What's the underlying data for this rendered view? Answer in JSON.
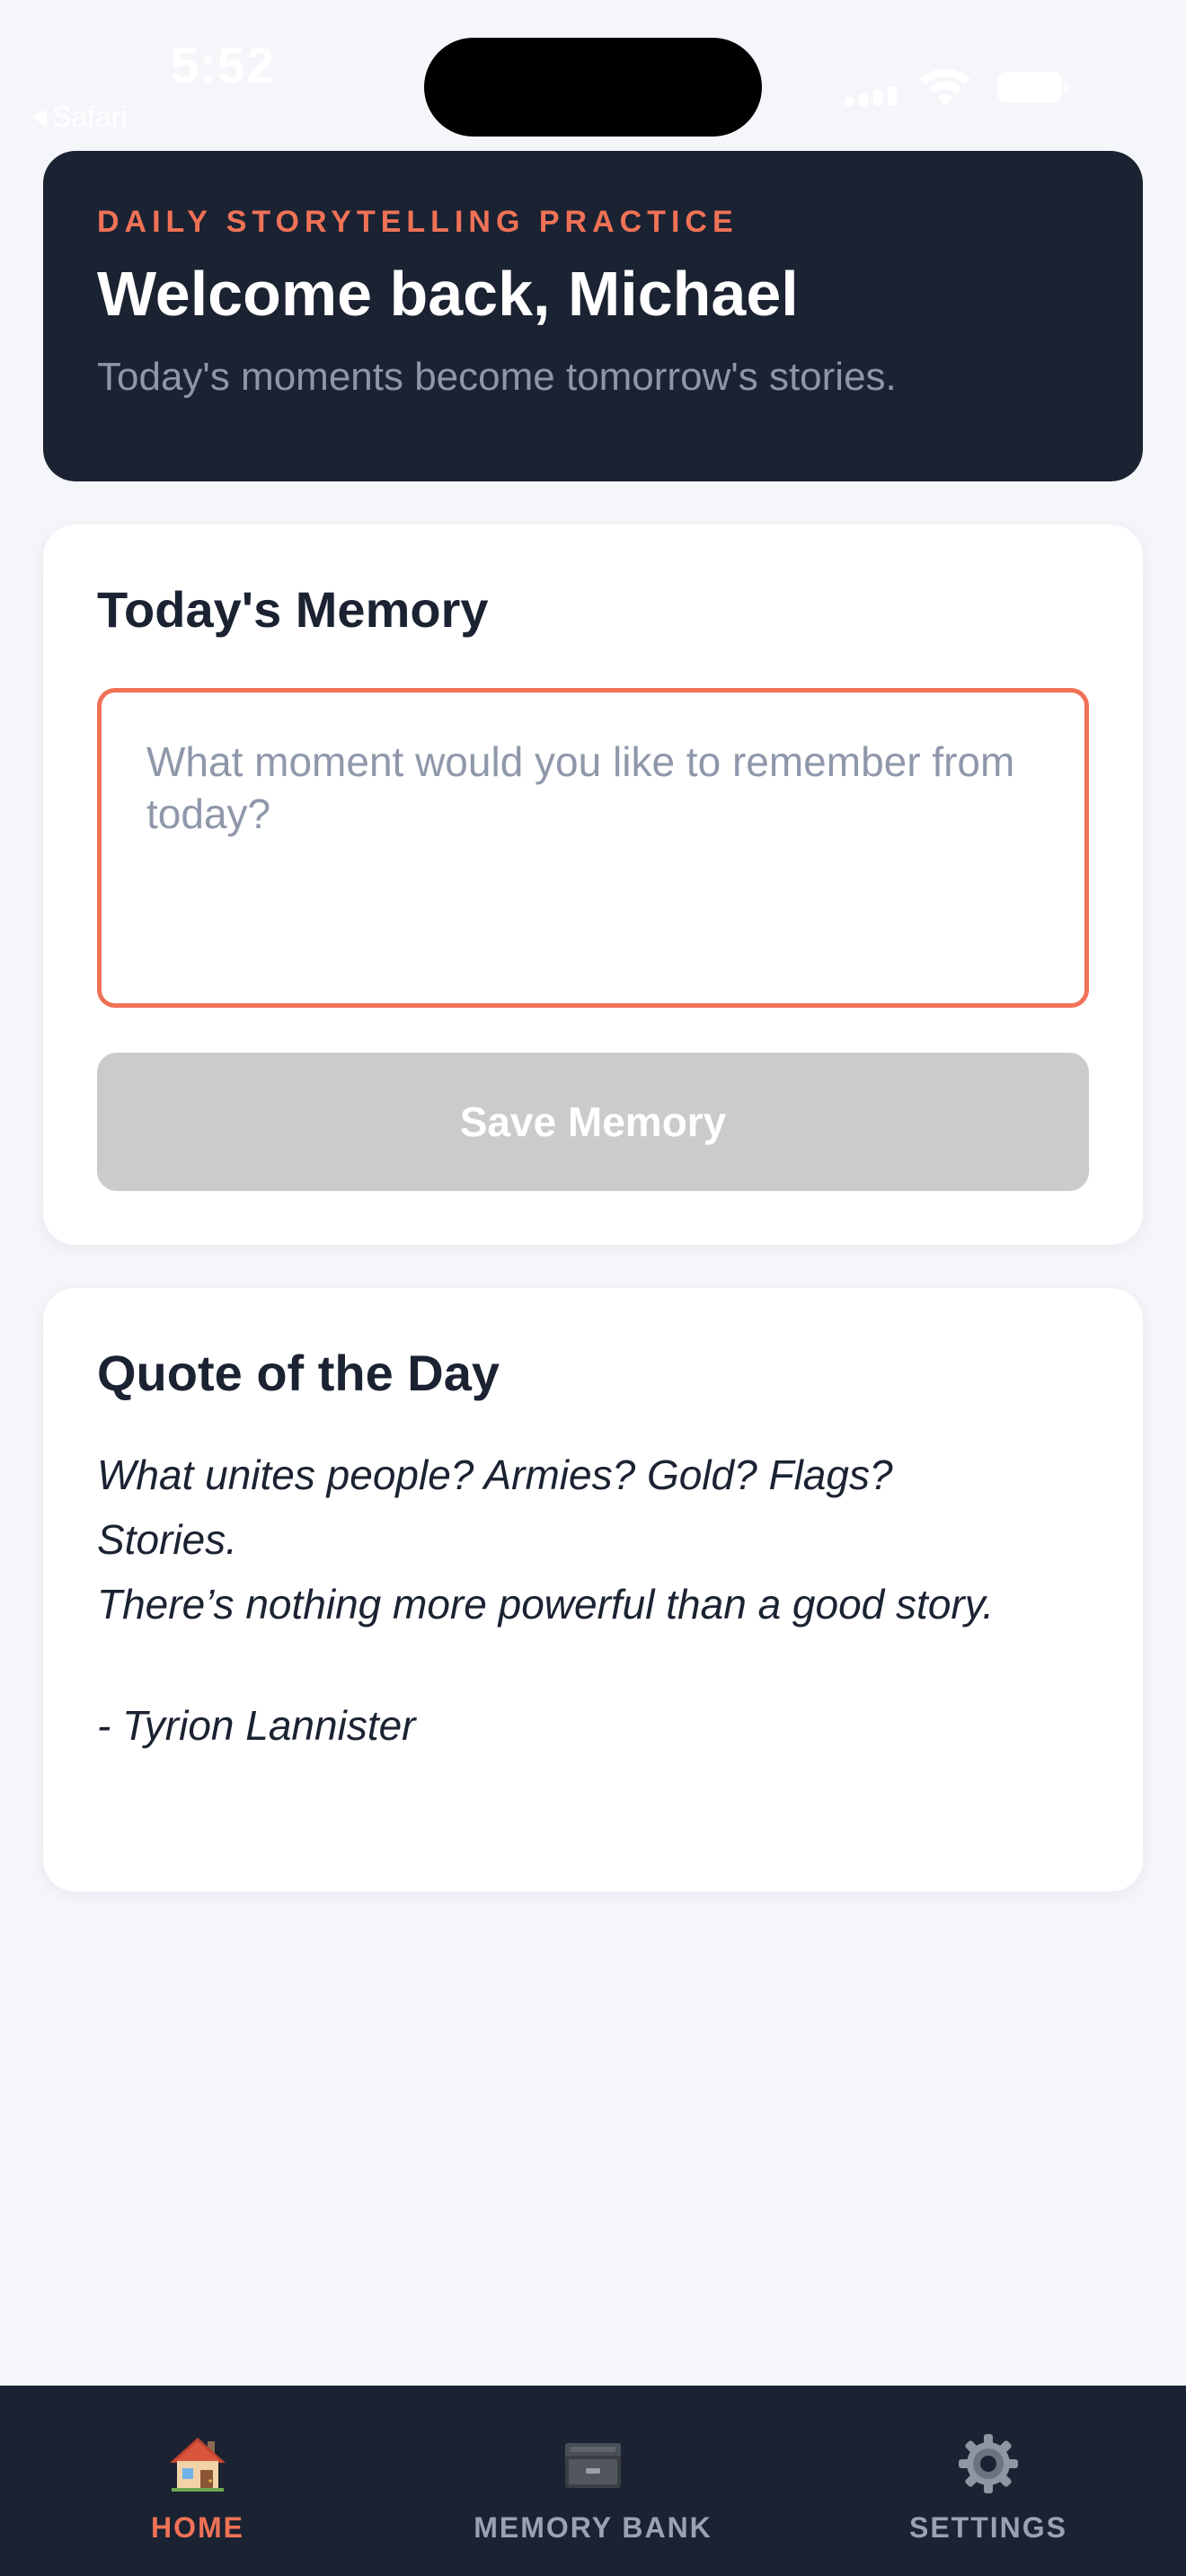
{
  "status_bar": {
    "time": "5:52",
    "back_label": "Safari"
  },
  "hero": {
    "eyebrow": "Daily Storytelling Practice",
    "title": "Welcome back, Michael",
    "subtitle": "Today's moments become tomorrow's stories."
  },
  "memory": {
    "title": "Today's Memory",
    "input_value": "",
    "input_placeholder": "What moment would you like to remember from today?",
    "save_label": "Save Memory"
  },
  "quote": {
    "title": "Quote of the Day",
    "line1": "What unites people? Armies? Gold? Flags?",
    "line2": "Stories.",
    "line3": "There’s nothing more powerful than a good story.",
    "author": "- Tyrion Lannister"
  },
  "tabs": [
    {
      "label": "HOME",
      "icon": "house-icon",
      "active": true
    },
    {
      "label": "MEMORY BANK",
      "icon": "file-cabinet-icon",
      "active": false
    },
    {
      "label": "SETTINGS",
      "icon": "gear-icon",
      "active": false
    }
  ],
  "colors": {
    "accent": "#f07256",
    "dark": "#1b2232",
    "background": "#f4f6fa",
    "button_disabled": "#cbcbcb"
  }
}
